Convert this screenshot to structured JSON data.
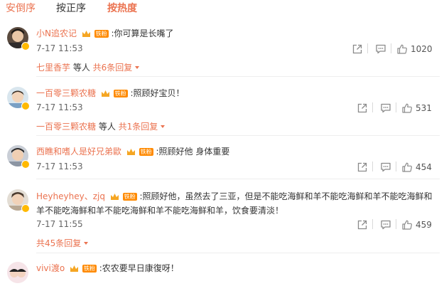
{
  "sort_tabs": [
    "安倒序",
    "按正序",
    "按热度"
  ],
  "fan_badge_text": "铁粉",
  "colors": {
    "accent": "#eb7350",
    "badge": "#ff8a00",
    "text": "#333333",
    "meta": "#666666"
  },
  "comments": [
    {
      "username": "小N追农记",
      "text": ":你可算是长嘴了",
      "time": "7-17 11:53",
      "likes": "1020",
      "replies": {
        "from": "七里香芋",
        "middle": " 等人 ",
        "count": "共6条回复"
      }
    },
    {
      "username": "一百零三颗农糖",
      "text": ":照顾好宝贝！",
      "time": "7-17 11:53",
      "likes": "531",
      "replies": {
        "from": "一百零三颗农糖",
        "middle": " 等人 ",
        "count": "共1条回复"
      }
    },
    {
      "username": "西瞧和嗜人是好兄弟歐",
      "text": ":照顾好他 身体重要",
      "time": "7-17 11:53",
      "likes": "454"
    },
    {
      "username": "Heyheyhey、zjq",
      "text": ":照顾好他，虽然去了三亚，但是不能吃海鲜和羊不能吃海鲜和羊不能吃海鲜和羊不能吃海鲜和羊不能吃海鲜和羊不能吃海鲜和羊，饮食要清淡！",
      "time": "7-17 11:55",
      "likes": "459",
      "replies": {
        "count": "共45条回复"
      }
    },
    {
      "username": "vivi渡o",
      "text": ":农农要早日康復呀！"
    }
  ]
}
